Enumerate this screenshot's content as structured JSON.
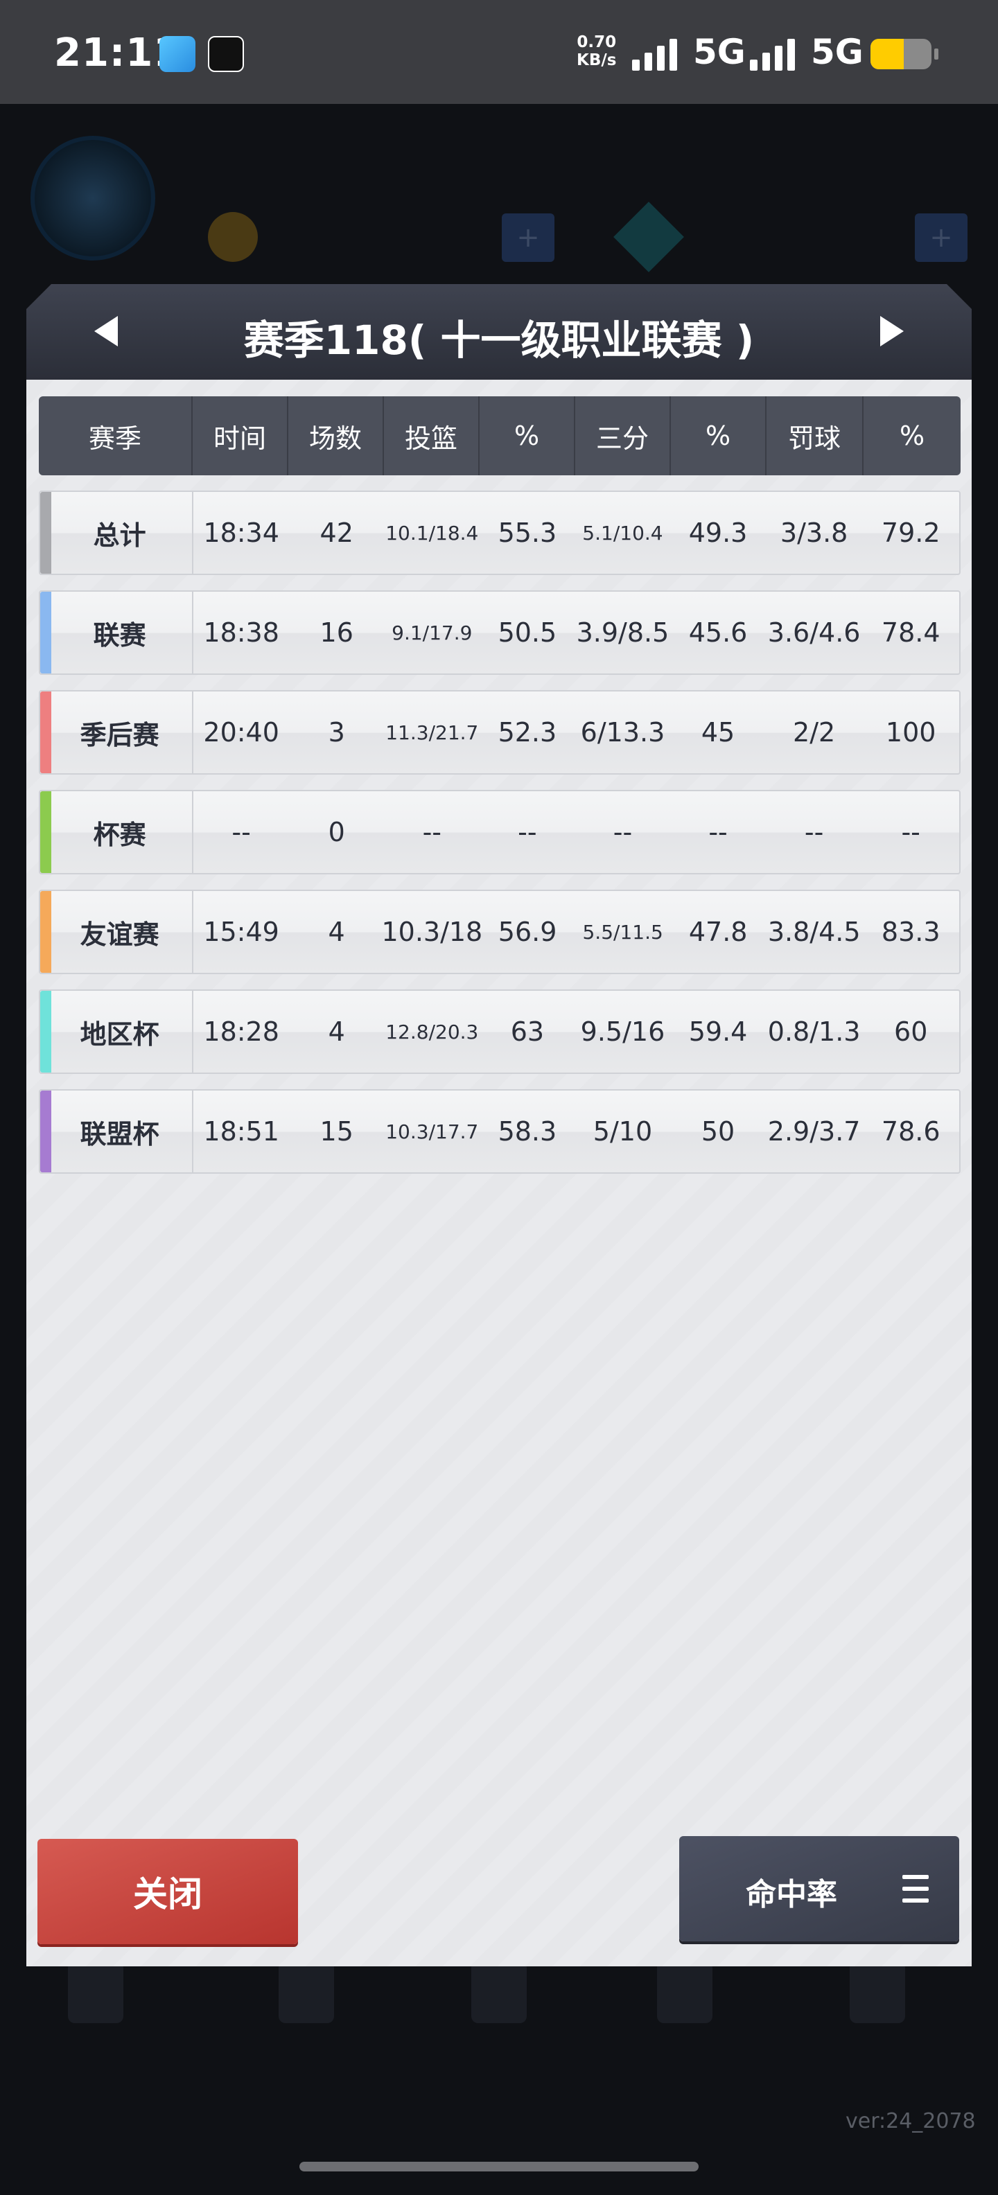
{
  "status_bar": {
    "time": "21:11",
    "net_speed_value": "0.70",
    "net_speed_unit": "KB/s",
    "network1": "5G",
    "network2": "5G",
    "battery_level": 0.55
  },
  "background": {
    "version": "ver:24_2078"
  },
  "dialog": {
    "title": "赛季118( 十一级职业联赛 )",
    "columns": [
      "赛季",
      "时间",
      "场数",
      "投篮",
      "%",
      "三分",
      "%",
      "罚球",
      "%"
    ],
    "rows": [
      {
        "name": "总计",
        "color": "#a8a9ad",
        "time": "18:34",
        "games": "42",
        "fg": "10.1/18.4",
        "fg_pct": "55.3",
        "three": "5.1/10.4",
        "three_pct": "49.3",
        "ft": "3/3.8",
        "ft_pct": "79.2"
      },
      {
        "name": "联赛",
        "color": "#8ab8f0",
        "time": "18:38",
        "games": "16",
        "fg": "9.1/17.9",
        "fg_pct": "50.5",
        "three": "3.9/8.5",
        "three_pct": "45.6",
        "ft": "3.6/4.6",
        "ft_pct": "78.4"
      },
      {
        "name": "季后赛",
        "color": "#ee7f80",
        "time": "20:40",
        "games": "3",
        "fg": "11.3/21.7",
        "fg_pct": "52.3",
        "three": "6/13.3",
        "three_pct": "45",
        "ft": "2/2",
        "ft_pct": "100"
      },
      {
        "name": "杯赛",
        "color": "#8ccb4e",
        "time": "--",
        "games": "0",
        "fg": "--",
        "fg_pct": "--",
        "three": "--",
        "three_pct": "--",
        "ft": "--",
        "ft_pct": "--"
      },
      {
        "name": "友谊赛",
        "color": "#f5a95a",
        "time": "15:49",
        "games": "4",
        "fg": "10.3/18",
        "fg_pct": "56.9",
        "three": "5.5/11.5",
        "three_pct": "47.8",
        "ft": "3.8/4.5",
        "ft_pct": "83.3"
      },
      {
        "name": "地区杯",
        "color": "#6fe2da",
        "time": "18:28",
        "games": "4",
        "fg": "12.8/20.3",
        "fg_pct": "63",
        "three": "9.5/16",
        "three_pct": "59.4",
        "ft": "0.8/1.3",
        "ft_pct": "60"
      },
      {
        "name": "联盟杯",
        "color": "#a67bd1",
        "time": "18:51",
        "games": "15",
        "fg": "10.3/17.7",
        "fg_pct": "58.3",
        "three": "5/10",
        "three_pct": "50",
        "ft": "2.9/3.7",
        "ft_pct": "78.6"
      }
    ],
    "close_label": "关闭",
    "rate_label": "命中率"
  }
}
